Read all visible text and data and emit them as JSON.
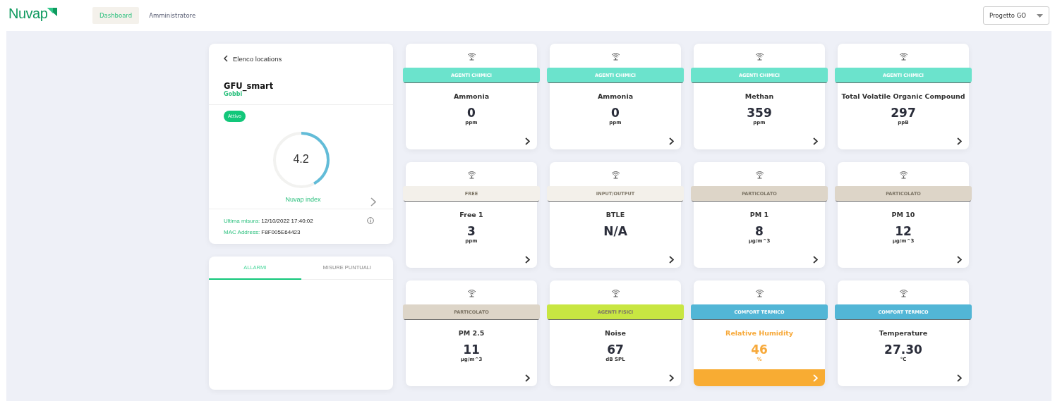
{
  "header": {
    "logo": "Nuvap",
    "nav": [
      {
        "label": "Dashboard",
        "selected": true
      },
      {
        "label": "Amministratore",
        "selected": false
      }
    ],
    "project_select": {
      "value": "Progetto GO"
    }
  },
  "location": {
    "back_link": "Elenco locations",
    "name": "GFU_smart",
    "owner": "Gobbi",
    "status": "Attivo",
    "index": {
      "value": "4.2",
      "level": 0.42,
      "label": "Nuvap index"
    },
    "last_measure_label": "Ultima misura:",
    "last_measure": "12/10/2022 17:40:02",
    "mac_label": "MAC Address:",
    "mac": "F8F005E64423"
  },
  "panel_tabs": [
    {
      "label": "ALLARMI",
      "selected": true
    },
    {
      "label": "MISURE PUNTUALI",
      "selected": false
    }
  ],
  "sensors": [
    {
      "category": "AGENTI CHIMICI",
      "color": "#6be3cc",
      "name": "Ammonia",
      "value": "0",
      "unit": "ppm",
      "alert": false
    },
    {
      "category": "AGENTI CHIMICI",
      "color": "#6be3cc",
      "name": "Ammonia",
      "value": "0",
      "unit": "ppm",
      "alert": false
    },
    {
      "category": "AGENTI CHIMICI",
      "color": "#6be3cc",
      "name": "Methan",
      "value": "359",
      "unit": "ppm",
      "alert": false
    },
    {
      "category": "AGENTI CHIMICI",
      "color": "#6be3cc",
      "name": "Total Volatile Organic Compound",
      "value": "297",
      "unit": "ppB",
      "alert": false
    },
    {
      "category": "FREE",
      "color": "#f3f0ea",
      "name": "Free 1",
      "value": "3",
      "unit": "ppm",
      "alert": false
    },
    {
      "category": "INPUT/OUTPUT",
      "color": "#f3f0ea",
      "name": "BTLE",
      "value": "N/A",
      "alert": false
    },
    {
      "category": "PARTICOLATO",
      "color": "#ddd5c8",
      "name": "PM 1",
      "value": "8",
      "unit": "µg/m^3",
      "alert": false
    },
    {
      "category": "PARTICOLATO",
      "color": "#ddd5c8",
      "name": "PM 10",
      "value": "12",
      "unit": "µg/m^3",
      "alert": false
    },
    {
      "category": "PARTICOLATO",
      "color": "#ddd5c8",
      "name": "PM 2.5",
      "value": "11",
      "unit": "µg/m^3",
      "alert": false
    },
    {
      "category": "AGENTI FISICI",
      "color": "#c8e642",
      "name": "Noise",
      "value": "67",
      "unit": "dB SPL",
      "alert": false
    },
    {
      "category": "COMFORT TERMICO",
      "color": "#52b6d6",
      "name": "Relative Humidity",
      "value": "46",
      "unit": "%",
      "alert": true
    },
    {
      "category": "COMFORT TERMICO",
      "color": "#52b6d6",
      "name": "Temperature",
      "value": "27.30",
      "unit": "°C",
      "alert": false
    }
  ]
}
